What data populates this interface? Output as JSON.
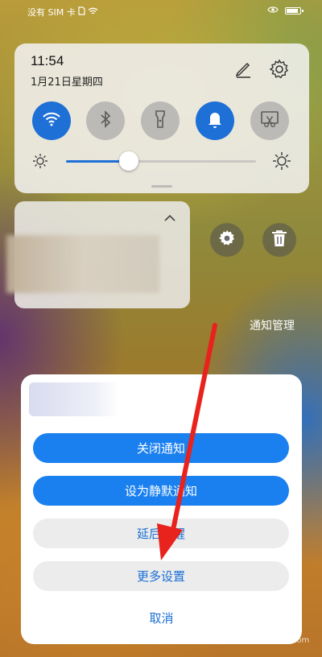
{
  "status_bar": {
    "carrier": "没有 SIM 卡",
    "icons": [
      "sim-icon",
      "wifi-icon",
      "eye-icon",
      "battery-icon"
    ]
  },
  "quick_settings": {
    "time": "11:54",
    "date": "1月21日星期四",
    "edit_icon": "pencil-icon",
    "settings_icon": "gear-icon",
    "tiles": [
      {
        "name": "wifi",
        "icon": "wifi-icon",
        "state": "on"
      },
      {
        "name": "bluetooth",
        "icon": "bluetooth-icon",
        "state": "off"
      },
      {
        "name": "flashlight",
        "icon": "flashlight-icon",
        "state": "off"
      },
      {
        "name": "sound",
        "icon": "bell-icon",
        "state": "on"
      },
      {
        "name": "screenshot",
        "icon": "screenshot-icon",
        "state": "off"
      }
    ],
    "brightness_level": 0.33,
    "accent_color": "#1e6fd6"
  },
  "notification": {
    "collapse_icon": "chevron-up-icon",
    "settings_icon": "gear-icon",
    "delete_icon": "trash-icon",
    "manage_label": "通知管理"
  },
  "sheet": {
    "buttons": [
      {
        "label": "关闭通知",
        "style": "primary"
      },
      {
        "label": "设为静默通知",
        "style": "primary"
      },
      {
        "label": "延后提醒",
        "style": "secondary"
      },
      {
        "label": "更多设置",
        "style": "secondary"
      }
    ],
    "cancel_label": "取消",
    "primary_color": "#1a80f0",
    "link_color": "#1a6fd6"
  },
  "annotation": {
    "arrow_color": "#e8231d"
  },
  "watermark": "jingyan.baidu.com"
}
